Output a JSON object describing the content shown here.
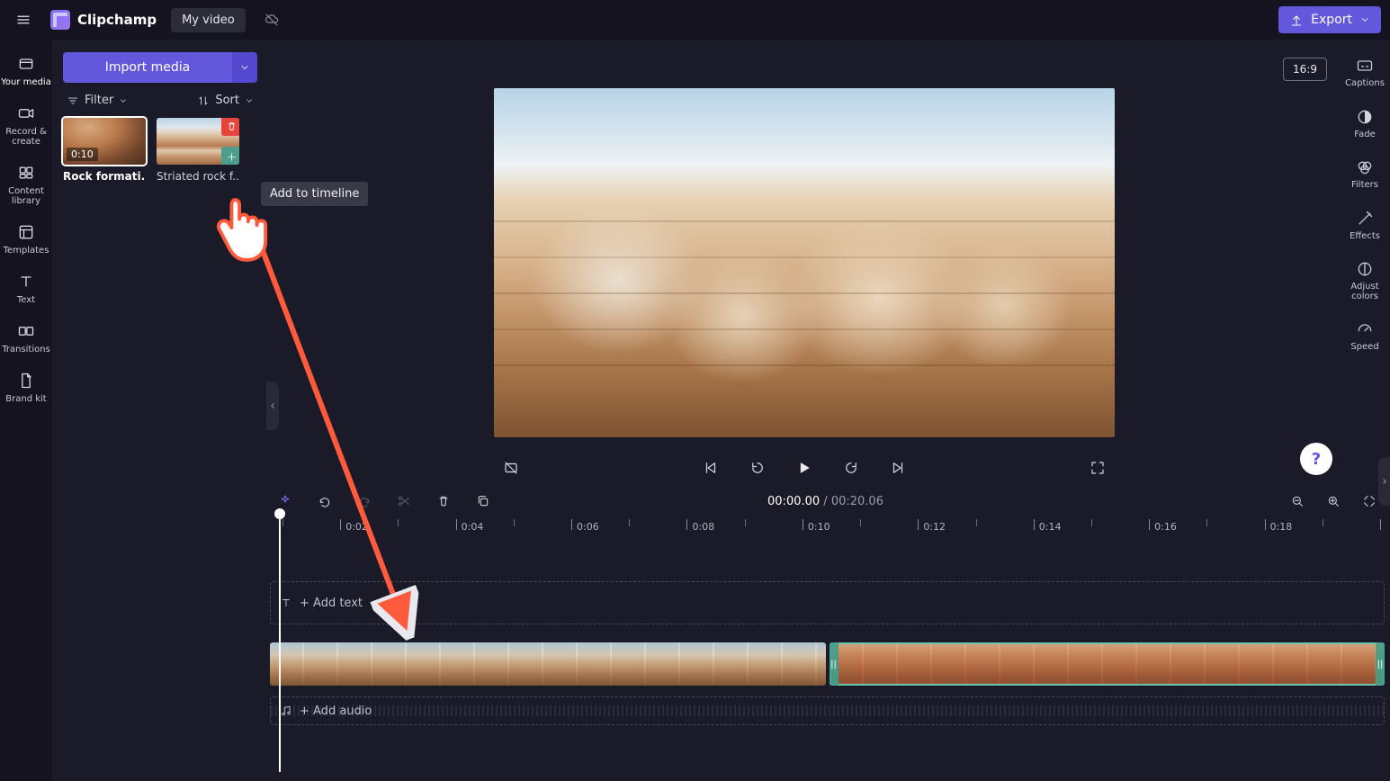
{
  "header": {
    "brand": "Clipchamp",
    "project": "My video",
    "export": "Export"
  },
  "left_rail": [
    {
      "id": "your-media",
      "label": "Your media"
    },
    {
      "id": "record-create",
      "label": "Record & create"
    },
    {
      "id": "content-library",
      "label": "Content library"
    },
    {
      "id": "templates",
      "label": "Templates"
    },
    {
      "id": "text",
      "label": "Text"
    },
    {
      "id": "transitions",
      "label": "Transitions"
    },
    {
      "id": "brand-kit",
      "label": "Brand kit"
    }
  ],
  "media_panel": {
    "import": "Import media",
    "filter": "Filter",
    "sort": "Sort",
    "thumbs": [
      {
        "name": "Rock formati...",
        "duration": "0:10",
        "selected": true
      },
      {
        "name": "Striated rock f...",
        "selected": false
      }
    ],
    "tooltip": "Add to timeline"
  },
  "preview": {
    "aspect": "16:9",
    "time_current": "00:00.00",
    "time_separator": " / ",
    "time_total": "00:20.06"
  },
  "right_rail": [
    {
      "id": "captions",
      "label": "Captions"
    },
    {
      "id": "fade",
      "label": "Fade"
    },
    {
      "id": "filters",
      "label": "Filters"
    },
    {
      "id": "effects",
      "label": "Effects"
    },
    {
      "id": "adjust-colors",
      "label": "Adjust colors"
    },
    {
      "id": "speed",
      "label": "Speed"
    }
  ],
  "timeline": {
    "ticks": [
      "0:02",
      "0:04",
      "0:06",
      "0:08",
      "0:10",
      "0:12",
      "0:14",
      "0:16",
      "0:18"
    ],
    "text_track_hint": "+ Add text",
    "audio_track_hint": "+ Add audio"
  }
}
